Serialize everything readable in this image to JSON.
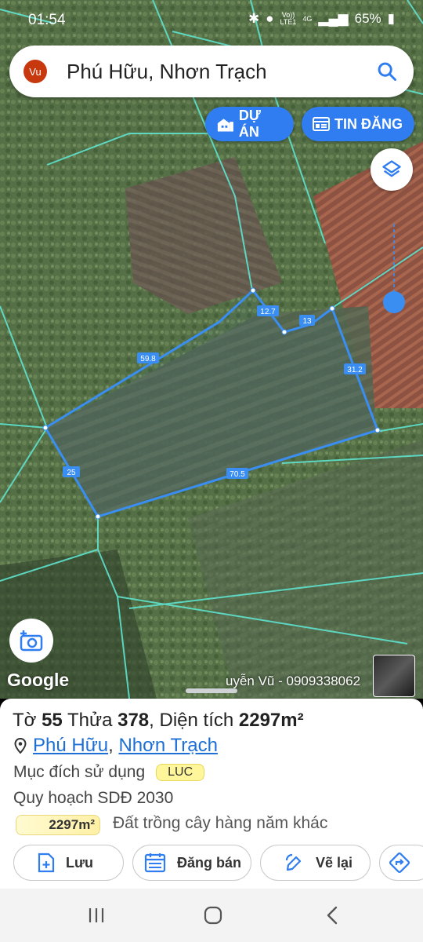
{
  "status": {
    "time": "01:54",
    "network_top": "Vo))",
    "network_bottom": "LTE1",
    "network_type": "4G",
    "battery": "65%"
  },
  "search": {
    "avatar": "Vu",
    "query": "Phú Hữu, Nhơn Trạch",
    "icon": "search-icon"
  },
  "pills": {
    "du_an": "DỰ ÁN",
    "tin_dang": "TIN ĐĂNG"
  },
  "map": {
    "edge_labels": [
      "59.8",
      "12.7",
      "13",
      "31.2",
      "70.5",
      "25"
    ],
    "google_logo": "Google",
    "author": "uyễn Vũ - 0909338062"
  },
  "parcel": {
    "title_prefix": "Tờ",
    "sheet_no": "55",
    "parcel_label": "Thửa",
    "parcel_no": "378",
    "area_label": ", Diện tích",
    "area_value": "2297m²",
    "commune": "Phú Hữu",
    "separator": ",",
    "district": "Nhơn Trạch",
    "purpose_label": "Mục đích sử dụng",
    "purpose_code": "LUC",
    "plan_label": "Quy hoạch SDĐ 2030",
    "plan_area": "2297m²",
    "plan_desc": "Đất trồng cây hàng năm khác"
  },
  "actions": {
    "save": "Lưu",
    "sell": "Đăng bán",
    "redraw": "Vẽ lại"
  },
  "colors": {
    "accent": "#2f7df0",
    "parcel_line": "#3a8ef2",
    "cadastral_line": "#5fe3cf",
    "badge_yellow": "#fff59a"
  }
}
